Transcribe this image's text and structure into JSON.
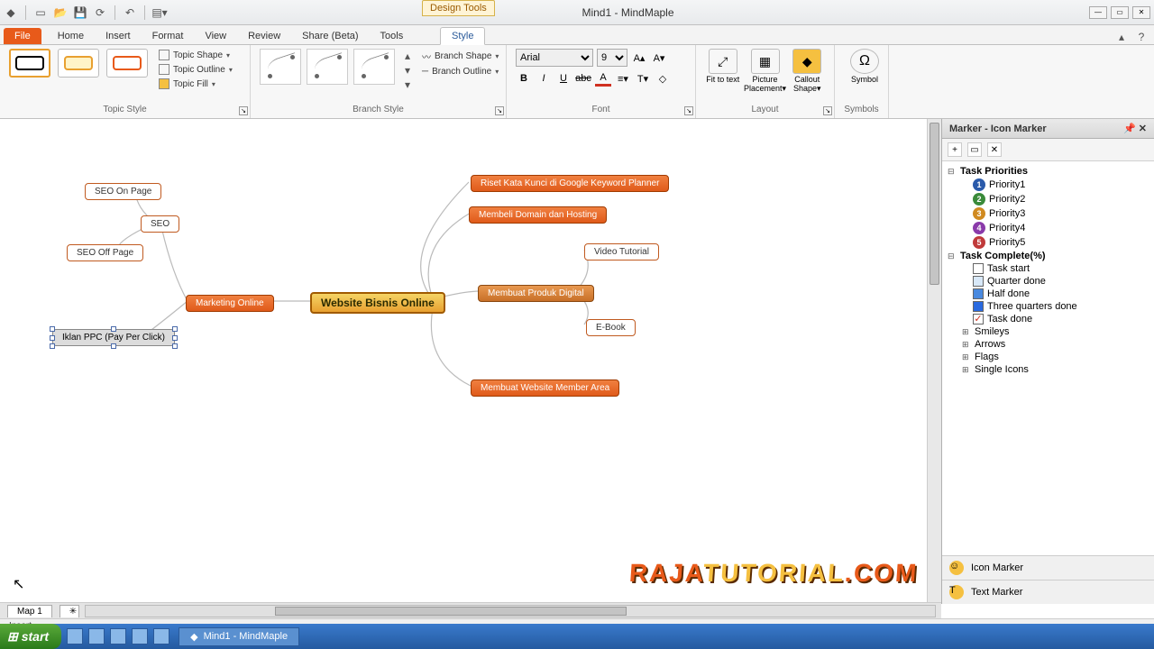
{
  "app": {
    "title_doc": "Mind1",
    "title_app": "MindMaple",
    "title_sep": " - ",
    "design_tools_label": "Design Tools"
  },
  "qat": {
    "icons": [
      "app",
      "new",
      "open",
      "save",
      "sync",
      "sep",
      "undo",
      "sep",
      "styles"
    ]
  },
  "tabs": {
    "file": "File",
    "list": [
      "Home",
      "Insert",
      "Format",
      "View",
      "Review",
      "Share (Beta)",
      "Tools"
    ],
    "style": "Style"
  },
  "ribbon": {
    "topic_style": {
      "label": "Topic Style",
      "btns": {
        "shape": "Topic Shape",
        "outline": "Topic Outline",
        "fill": "Topic Fill"
      }
    },
    "branch_style": {
      "label": "Branch Style",
      "btns": {
        "shape": "Branch Shape",
        "outline": "Branch Outline"
      }
    },
    "font": {
      "label": "Font",
      "name": "Arial",
      "size": "9"
    },
    "layout": {
      "label": "Layout",
      "fit": "Fit to text",
      "picture": "Picture Placement",
      "callout": "Callout Shape"
    },
    "symbols": {
      "label": "Symbols",
      "btn": "Symbol"
    }
  },
  "nodes": {
    "center": "Website Bisnis Online",
    "riset": "Riset Kata Kunci di Google Keyword Planner",
    "domain": "Membeli Domain dan Hosting",
    "produk": "Membuat Produk Digital",
    "video": "Video Tutorial",
    "ebook": "E-Book",
    "member": "Membuat Website Member Area",
    "marketing": "Marketing Online",
    "seo": "SEO",
    "seo_on": "SEO On Page",
    "seo_off": "SEO Off Page",
    "ppc": "Iklan PPC (Pay Per Click)"
  },
  "panel": {
    "title": "Marker - Icon Marker",
    "groups": {
      "priorities": {
        "label": "Task Priorities",
        "items": [
          "Priority1",
          "Priority2",
          "Priority3",
          "Priority4",
          "Priority5"
        ]
      },
      "complete": {
        "label": "Task Complete(%)",
        "items": [
          "Task start",
          "Quarter done",
          "Half done",
          "Three quarters done",
          "Task done"
        ]
      },
      "others": [
        "Smileys",
        "Arrows",
        "Flags",
        "Single Icons"
      ]
    },
    "sections": {
      "icon": "Icon Marker",
      "text": "Text Marker"
    }
  },
  "colors": {
    "priority": [
      "#2a5aaa",
      "#3a8a3a",
      "#d08a20",
      "#8a3aaa",
      "#c03a3a"
    ],
    "complete": [
      "#ffffff",
      "#d8e8f8",
      "#4a8ae0",
      "#2a6ae0",
      "#1a4ac0"
    ],
    "done_check": "#d03020"
  },
  "bottom": {
    "sheet": "Map 1",
    "status": "Insert",
    "start": "start",
    "task": "Mind1 - MindMaple"
  },
  "watermark": {
    "a": "RAJA",
    "b": "TUTORIAL",
    "c": ".COM"
  }
}
